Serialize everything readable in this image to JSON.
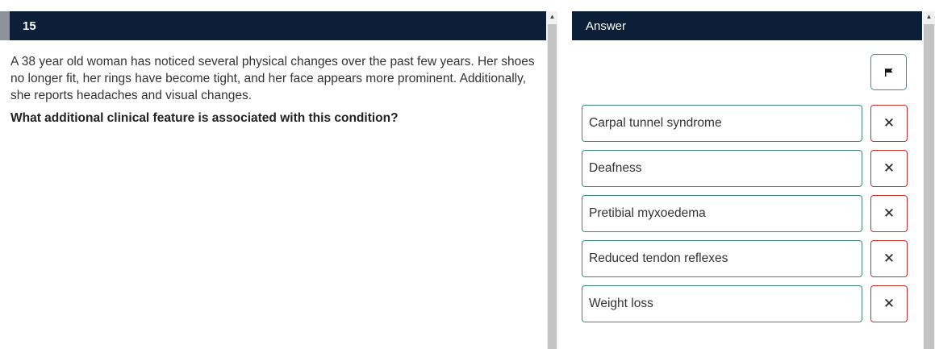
{
  "question_panel": {
    "number": "15",
    "stem": "A 38 year old woman has noticed several physical changes over the past few years. Her shoes no longer fit, her rings have become tight, and her face appears more prominent. Additionally, she reports headaches and visual changes.",
    "prompt": "What additional clinical feature is associated with this condition?"
  },
  "answer_panel": {
    "title": "Answer",
    "flag_icon": "flag-icon",
    "cross_glyph": "✕",
    "options": [
      {
        "label": "Carpal tunnel syndrome"
      },
      {
        "label": "Deafness"
      },
      {
        "label": "Pretibial myxoedema"
      },
      {
        "label": "Reduced tendon reflexes"
      },
      {
        "label": "Weight loss"
      }
    ]
  },
  "colors": {
    "header_bg": "#0b1f38",
    "option_border": "#3d8a6e",
    "cross_border": "#d12b2b",
    "flag_border": "#3d86b5"
  }
}
